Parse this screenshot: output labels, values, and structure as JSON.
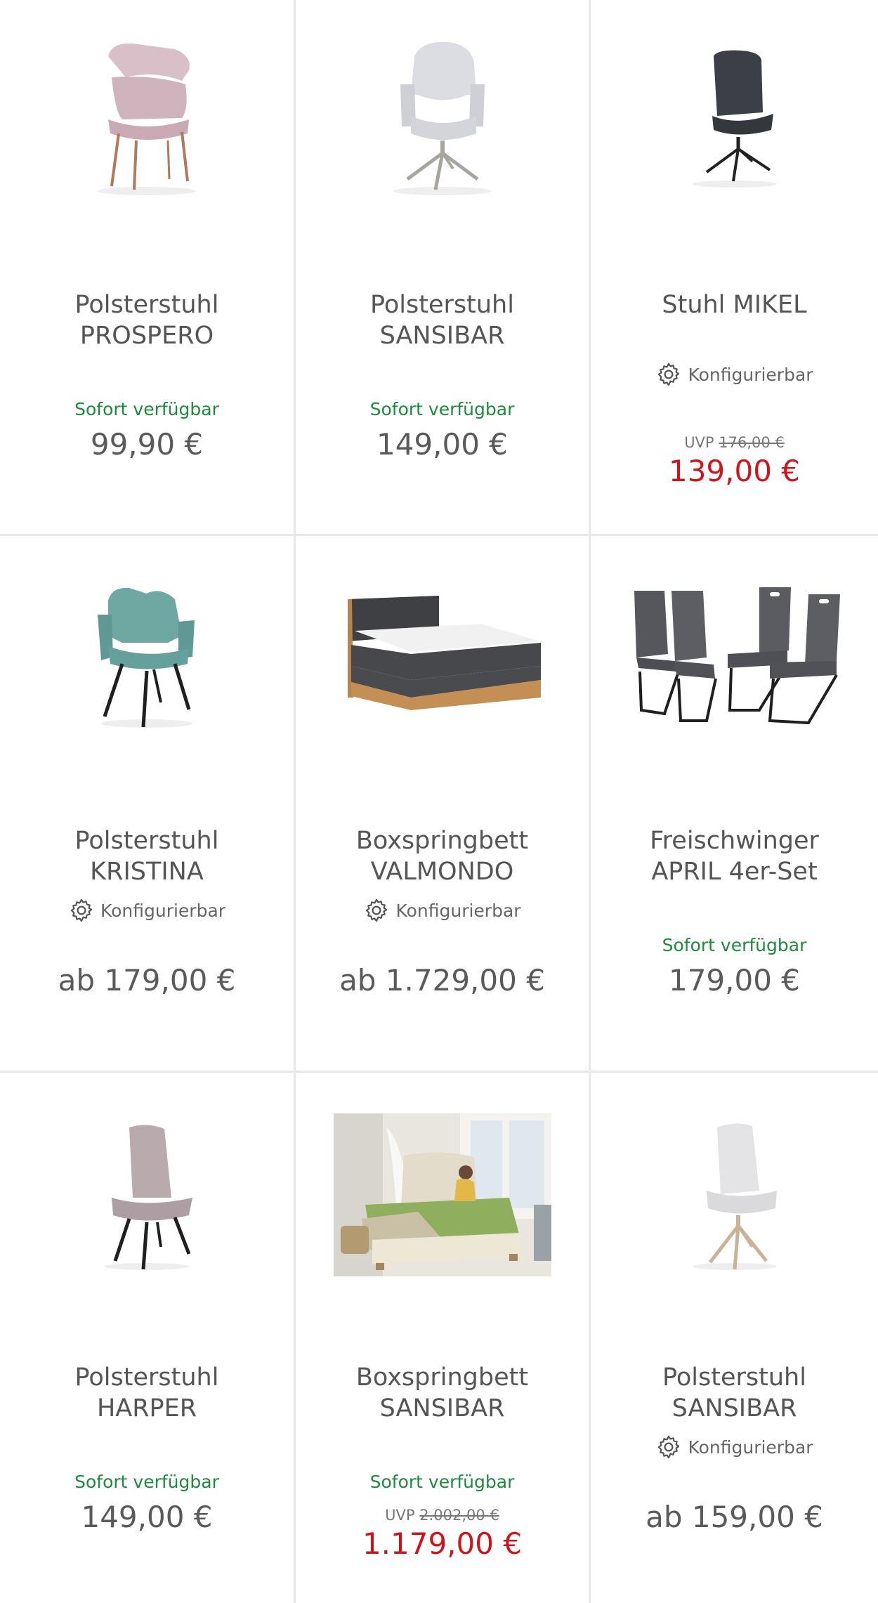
{
  "products": [
    {
      "name_line1": "Polsterstuhl",
      "name_line2": "PROSPERO",
      "availability": "Sofort verfügbar",
      "price": "99,90 €",
      "image_icon": "chair-image"
    },
    {
      "name_line1": "Polsterstuhl",
      "name_line2": "SANSIBAR",
      "availability": "Sofort verfügbar",
      "price": "149,00 €",
      "image_icon": "chair-image"
    },
    {
      "name_line1": "Stuhl MIKEL",
      "config_label": "Konfigurierbar",
      "uvp_label": "UVP",
      "uvp_price": "176,00 €",
      "sale_price": "139,00 €",
      "image_icon": "chair-image"
    },
    {
      "name_line1": "Polsterstuhl",
      "name_line2": "KRISTINA",
      "config_label": "Konfigurierbar",
      "price": "ab 179,00 €",
      "image_icon": "chair-image"
    },
    {
      "name_line1": "Boxspringbett",
      "name_line2": "VALMONDO",
      "config_label": "Konfigurierbar",
      "price": "ab 1.729,00 €",
      "image_icon": "bed-image"
    },
    {
      "name_line1": "Freischwinger",
      "name_line2": "APRIL 4er-Set",
      "availability": "Sofort verfügbar",
      "price": "179,00 €",
      "image_icon": "chair-set-image"
    },
    {
      "name_line1": "Polsterstuhl",
      "name_line2": "HARPER",
      "availability": "Sofort verfügbar",
      "price": "149,00 €",
      "image_icon": "chair-image"
    },
    {
      "name_line1": "Boxspringbett",
      "name_line2": "SANSIBAR",
      "availability": "Sofort verfügbar",
      "uvp_label": "UVP",
      "uvp_price": "2.002,00 €",
      "sale_price": "1.179,00 €",
      "image_icon": "bedroom-photo"
    },
    {
      "name_line1": "Polsterstuhl",
      "name_line2": "SANSIBAR",
      "config_label": "Konfigurierbar",
      "price": "ab 159,00 €",
      "image_icon": "chair-image"
    }
  ],
  "colors": {
    "available_green": "#1f8a3d",
    "sale_red": "#d0141b",
    "text_gray": "#5a5a5a",
    "divider": "#e8e8e8"
  }
}
